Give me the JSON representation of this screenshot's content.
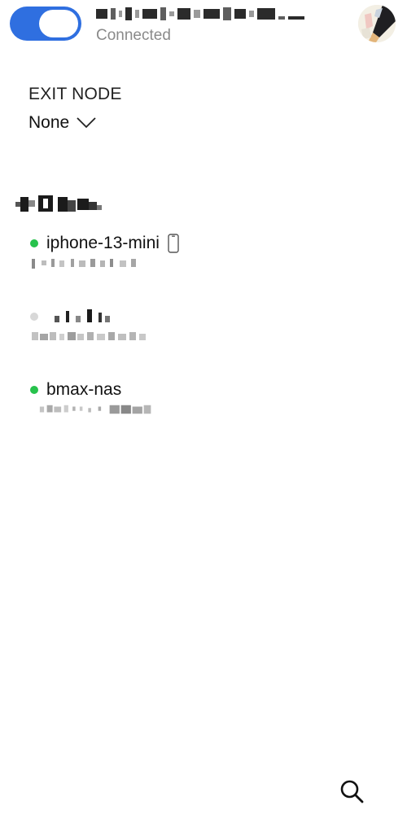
{
  "header": {
    "vpn_toggle_on": true,
    "status": "Connected",
    "accent_color": "#2f6fe0"
  },
  "exit_node": {
    "label": "EXIT NODE",
    "value": "None"
  },
  "devices": [
    {
      "name": "iphone-13-mini",
      "online": true,
      "status_color": "#27c24c",
      "icon": "phone-icon"
    },
    {
      "name": "",
      "online": false,
      "status_color": "#d8d8d8",
      "icon": ""
    },
    {
      "name": "bmax-nas",
      "online": true,
      "status_color": "#27c24c",
      "icon": ""
    }
  ],
  "footer": {
    "search_icon": "search-icon"
  }
}
